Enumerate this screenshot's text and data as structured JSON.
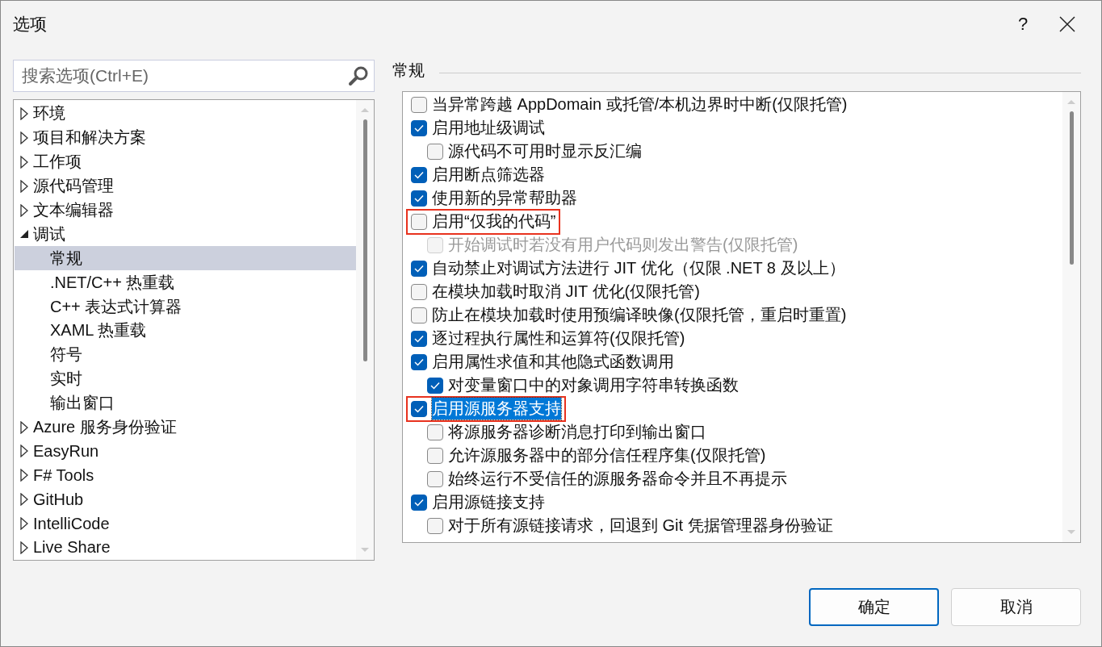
{
  "window": {
    "title": "选项",
    "help": "?"
  },
  "search": {
    "placeholder": "搜索选项(Ctrl+E)"
  },
  "tree": [
    {
      "label": "环境",
      "expanded": false,
      "selected": false
    },
    {
      "label": "项目和解决方案",
      "expanded": false,
      "selected": false
    },
    {
      "label": "工作项",
      "expanded": false,
      "selected": false
    },
    {
      "label": "源代码管理",
      "expanded": false,
      "selected": false
    },
    {
      "label": "文本编辑器",
      "expanded": false,
      "selected": false
    },
    {
      "label": "调试",
      "expanded": true,
      "selected": false,
      "children": [
        {
          "label": "常规",
          "selected": true
        },
        {
          "label": ".NET/C++ 热重载",
          "selected": false
        },
        {
          "label": "C++ 表达式计算器",
          "selected": false
        },
        {
          "label": "XAML 热重载",
          "selected": false
        },
        {
          "label": "符号",
          "selected": false
        },
        {
          "label": "实时",
          "selected": false
        },
        {
          "label": "输出窗口",
          "selected": false
        }
      ]
    },
    {
      "label": "Azure 服务身份验证",
      "expanded": false,
      "selected": false
    },
    {
      "label": "EasyRun",
      "expanded": false,
      "selected": false
    },
    {
      "label": "F# Tools",
      "expanded": false,
      "selected": false
    },
    {
      "label": "GitHub",
      "expanded": false,
      "selected": false
    },
    {
      "label": "IntelliCode",
      "expanded": false,
      "selected": false
    },
    {
      "label": "Live Share",
      "expanded": false,
      "selected": false
    }
  ],
  "section_title": "常规",
  "options": [
    {
      "label": "当异常跨越 AppDomain 或托管/本机边界时中断(仅限托管)",
      "checked": false,
      "disabled": false,
      "highlighted": false,
      "selected": false
    },
    {
      "label": "启用地址级调试",
      "checked": true,
      "disabled": false,
      "highlighted": false,
      "selected": false,
      "children": [
        {
          "label": "源代码不可用时显示反汇编",
          "checked": false,
          "disabled": false,
          "highlighted": false,
          "selected": false
        }
      ]
    },
    {
      "label": "启用断点筛选器",
      "checked": true,
      "disabled": false,
      "highlighted": false,
      "selected": false
    },
    {
      "label": "使用新的异常帮助器",
      "checked": true,
      "disabled": false,
      "highlighted": false,
      "selected": false
    },
    {
      "label": "启用“仅我的代码”",
      "checked": false,
      "disabled": false,
      "highlighted": true,
      "selected": false,
      "children": [
        {
          "label": "开始调试时若没有用户代码则发出警告(仅限托管)",
          "checked": false,
          "disabled": true,
          "highlighted": false,
          "selected": false
        }
      ]
    },
    {
      "label": "自动禁止对调试方法进行 JIT 优化（仅限 .NET 8 及以上）",
      "checked": true,
      "disabled": false,
      "highlighted": false,
      "selected": false
    },
    {
      "label": "在模块加载时取消 JIT 优化(仅限托管)",
      "checked": false,
      "disabled": false,
      "highlighted": false,
      "selected": false
    },
    {
      "label": "防止在模块加载时使用预编译映像(仅限托管，重启时重置)",
      "checked": false,
      "disabled": false,
      "highlighted": false,
      "selected": false
    },
    {
      "label": "逐过程执行属性和运算符(仅限托管)",
      "checked": true,
      "disabled": false,
      "highlighted": false,
      "selected": false
    },
    {
      "label": "启用属性求值和其他隐式函数调用",
      "checked": true,
      "disabled": false,
      "highlighted": false,
      "selected": false,
      "children": [
        {
          "label": "对变量窗口中的对象调用字符串转换函数",
          "checked": true,
          "disabled": false,
          "highlighted": false,
          "selected": false
        }
      ]
    },
    {
      "label": "启用源服务器支持",
      "checked": true,
      "disabled": false,
      "highlighted": true,
      "selected": true,
      "children": [
        {
          "label": "将源服务器诊断消息打印到输出窗口",
          "checked": false,
          "disabled": false,
          "highlighted": false,
          "selected": false
        },
        {
          "label": "允许源服务器中的部分信任程序集(仅限托管)",
          "checked": false,
          "disabled": false,
          "highlighted": false,
          "selected": false
        },
        {
          "label": "始终运行不受信任的源服务器命令并且不再提示",
          "checked": false,
          "disabled": false,
          "highlighted": false,
          "selected": false
        }
      ]
    },
    {
      "label": "启用源链接支持",
      "checked": true,
      "disabled": false,
      "highlighted": false,
      "selected": false,
      "children": [
        {
          "label": "对于所有源链接请求，回退到 Git 凭据管理器身份验证",
          "checked": false,
          "disabled": false,
          "highlighted": false,
          "selected": false
        }
      ]
    }
  ],
  "buttons": [
    {
      "label": "确定",
      "default": true
    },
    {
      "label": "取消",
      "default": false
    }
  ]
}
